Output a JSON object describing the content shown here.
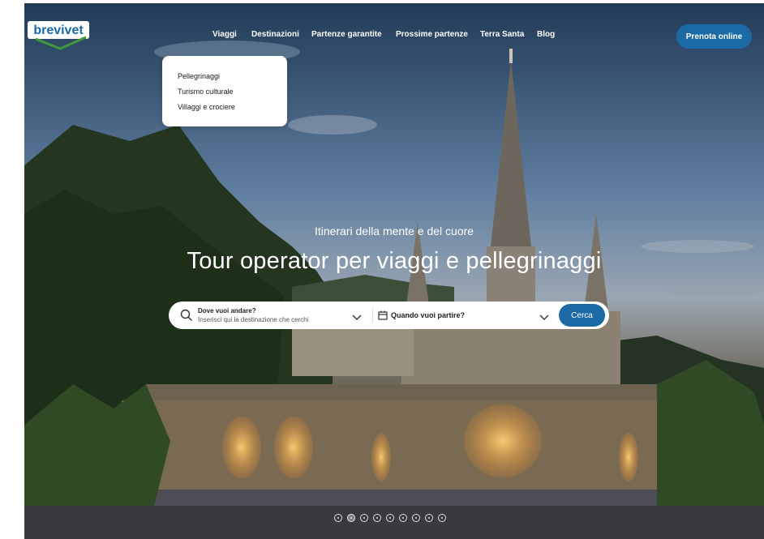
{
  "brand": {
    "logo_text": "brevivet",
    "color": "#1b6aa5"
  },
  "nav": {
    "items": [
      {
        "label": "Viaggi"
      },
      {
        "label": "Destinazioni"
      },
      {
        "label": "Partenze garantite"
      },
      {
        "label": "Prossime partenze"
      },
      {
        "label": "Terra Santa"
      },
      {
        "label": "Blog"
      }
    ],
    "cta_label": "Prenota online"
  },
  "dropdown": {
    "items": [
      {
        "label": "Pellegrinaggi"
      },
      {
        "label": "Turismo culturale"
      },
      {
        "label": "Villaggi e crociere"
      }
    ]
  },
  "hero": {
    "tagline": "Itinerari della mente e del cuore",
    "headline": "Tour operator per viaggi e pellegrinaggi"
  },
  "search": {
    "where_label": "Dove vuoi andare?",
    "where_placeholder": "Inserisci qui la destinazione che cerchi",
    "when_label": "Quando vuoi partire?",
    "submit_label": "Cerca"
  },
  "carousel": {
    "slide_count": 9,
    "active_index": 1
  },
  "icons": {
    "search": "search-icon",
    "calendar": "calendar-icon",
    "chevron": "chevron-down-icon"
  },
  "colors": {
    "accent": "#1b6aa5",
    "dropdown_bg": "#ffffff"
  }
}
